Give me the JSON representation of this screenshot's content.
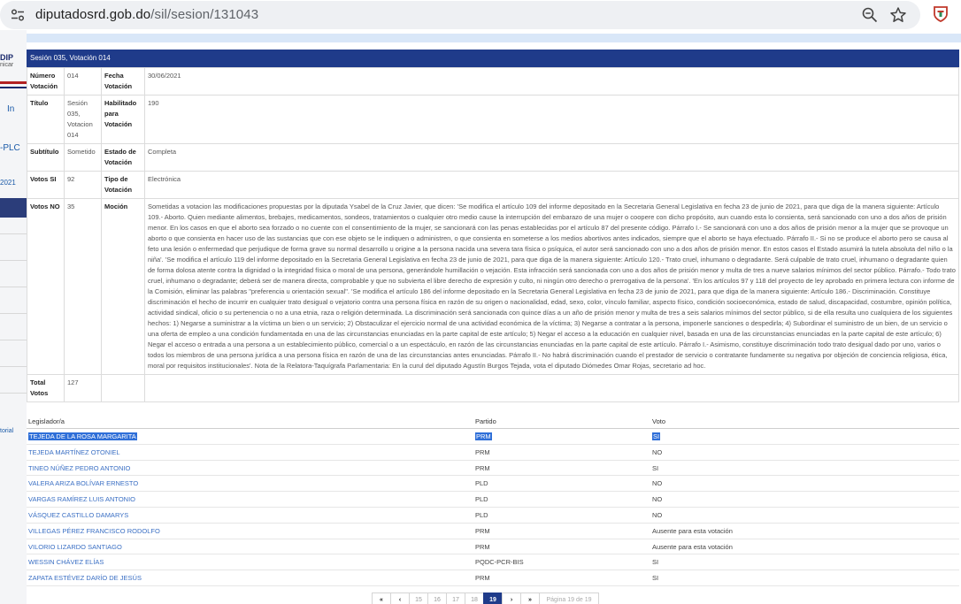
{
  "browser": {
    "host": "diputadosrd.gob.do",
    "path": "/sil/sesion/131043"
  },
  "background": {
    "logo": "DIP",
    "logo_sub": "nicar",
    "link_in": "In",
    "link_pl": "-PLC",
    "year": "2021",
    "torial": "torial"
  },
  "panel": {
    "header": "Sesión 035, Votación 014",
    "labels": {
      "numero": "Número Votación",
      "fecha": "Fecha Votación",
      "titulo": "Título",
      "habilitado": "Habilitado para Votación",
      "subtitulo": "Subtítulo",
      "estado": "Estado de Votación",
      "votos_si": "Votos SI",
      "tipo": "Tipo de Votación",
      "votos_no": "Votos NO",
      "mocion": "Moción",
      "total": "Total Votos"
    },
    "values": {
      "numero": "014",
      "fecha": "30/06/2021",
      "titulo": "Sesión 035, Votacion 014",
      "habilitado": "190",
      "subtitulo": "Sometido",
      "estado": "Completa",
      "votos_si": "92",
      "tipo": "Electrónica",
      "votos_no": "35",
      "total": "127",
      "mocion": "Sometidas a votacion las modificaciones propuestas por la diputada Ysabel de la Cruz Javier, que dicen: 'Se modifica el artículo 109 del informe depositado en la Secretaria General Legislativa en fecha 23 de junio de 2021, para que diga de la manera siguiente: Artículo 109.- Aborto. Quien mediante alimentos, brebajes, medicamentos, sondeos, tratamientos o cualquier otro medio cause la interrupción del embarazo de una mujer o coopere con dicho propósito, aun cuando esta lo consienta, será sancionado con uno a dos años de prisión menor. En los casos en que el aborto sea forzado o no cuente con el consentimiento de la mujer, se sancionará con las penas establecidas por el artículo 87 del presente código. Párrafo I.- Se sancionará con uno a dos años de prisión menor a la mujer que se provoque un aborto o que consienta en hacer uso de las sustancias que con ese objeto se le indiquen o administren, o que consienta en someterse a los medios abortivos antes indicados, siempre que el aborto se haya efectuado. Párrafo II.- Si no se produce el aborto pero se causa al feto una lesión o enfermedad que perjudique de forma grave su normal desarrollo u origine a la persona nacida una severa tara física o psíquica, el autor será sancionado con uno a dos años de prisión menor. En estos casos el Estado asumirá la tutela absoluta del niño o la niña'. 'Se modifica el artículo 119 del informe depositado en la Secretaria General Legislativa en fecha 23 de junio de 2021, para que diga de la manera siguiente: Artículo 120.- Trato cruel, inhumano o degradante. Será culpable de trato cruel, inhumano o degradante quien de forma dolosa atente contra la dignidad o la integridad física o moral de una persona, generándole humillación o vejación. Esta infracción será sancionada con uno a dos años de prisión menor y multa de tres a nueve salarios mínimos del sector público. Párrafo.- Todo trato cruel, inhumano o degradante; deberá ser de manera directa, comprobable y que no subvierta el libre derecho de expresión y culto, ni ningún otro derecho o prerrogativa de la persona'. 'En los artículos 97 y 118 del proyecto de ley aprobado en primera lectura con informe de la Comisión, eliminar las palabras \"preferencia u orientación sexual\". 'Se modifica el artículo 186 del informe depositado en la Secretaria General Legislativa en fecha 23 de junio de 2021, para que diga de la manera siguiente: Artículo 186.- Discriminación. Constituye discriminación el hecho de incurrir en cualquier trato desigual o vejatorio contra una persona física en razón de su origen o nacionalidad, edad, sexo, color, vínculo familiar, aspecto físico, condición socioeconómica, estado de salud, discapacidad, costumbre, opinión política, actividad sindical, oficio o su pertenencia o no a una etnia, raza o religión determinada. La discriminación será sancionada con quince días a un año de prisión menor y multa de tres a seis salarios mínimos del sector público, si de ella resulta uno cualquiera de los siguientes hechos: 1) Negarse a suministrar a la víctima un bien o un servicio; 2) Obstaculizar el ejercicio normal de una actividad económica de la víctima; 3) Negarse a contratar a la persona, imponerle sanciones o despedirla; 4) Subordinar el suministro de un bien, de un servicio o una oferta de empleo a una condición fundamentada en una de las circunstancias enunciadas en la parte capital de este artículo; 5) Negar el acceso a la educación en cualquier nivel, basada en una de las circunstancias enunciadas en la parte capital de este artículo; 6) Negar el acceso o entrada a una persona a un establecimiento público, comercial o a un espectáculo, en razón de las circunstancias enunciadas en la parte capital de este artículo. Párrafo I.- Asimismo, constituye discriminación todo trato desigual dado por uno, varios o todos los miembros de una persona jurídica a una persona física en razón de una de las circunstancias antes enunciadas. Párrafo II.- No habrá discriminación cuando el prestador de servicio o contratante fundamente su negativa por objeción de conciencia religiosa, ética, moral por requisitos institucionales'. Nota de la Relatora-Taquígrafa Parlamentaria: En la curul del diputado Agustín Burgos Tejada, vota el diputado Diómedes Omar Rojas, secretario ad hoc."
    }
  },
  "votes": {
    "headers": [
      "Legislador/a",
      "Partido",
      "Voto"
    ],
    "rows": [
      {
        "name": "TEJEDA DE LA ROSA MARGARITA",
        "party": "PRM",
        "vote": "SI"
      },
      {
        "name": "TEJEDA MARTÍNEZ OTONIEL",
        "party": "PRM",
        "vote": "NO"
      },
      {
        "name": "TINEO NÚÑEZ PEDRO ANTONIO",
        "party": "PRM",
        "vote": "SI"
      },
      {
        "name": "VALERA ARIZA BOLÍVAR ERNESTO",
        "party": "PLD",
        "vote": "NO"
      },
      {
        "name": "VARGAS RAMÍREZ LUIS ANTONIO",
        "party": "PLD",
        "vote": "NO"
      },
      {
        "name": "VÁSQUEZ CASTILLO DAMARYS",
        "party": "PLD",
        "vote": "NO"
      },
      {
        "name": "VILLEGAS PÉREZ FRANCISCO RODOLFO",
        "party": "PRM",
        "vote": "Ausente para esta votación"
      },
      {
        "name": "VILORIO LIZARDO SANTIAGO",
        "party": "PRM",
        "vote": "Ausente para esta votación"
      },
      {
        "name": "WESSIN CHÁVEZ ELÍAS",
        "party": "PQDC-PCR-BIS",
        "vote": "SI"
      },
      {
        "name": "ZAPATA ESTÉVEZ DARÍO DE JESÚS",
        "party": "PRM",
        "vote": "SI"
      }
    ]
  },
  "pagination": {
    "first": "«",
    "prev": "‹",
    "pages": [
      "15",
      "16",
      "17",
      "18",
      "19"
    ],
    "next": "›",
    "last": "»",
    "summary": "Página 19 de 19"
  },
  "colors": {
    "header_blue": "#1f3b8a",
    "link_blue": "#3a6fc4",
    "selection": "#2f6fd8"
  }
}
